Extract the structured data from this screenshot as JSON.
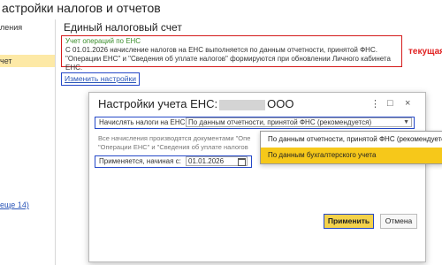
{
  "page_title": "астройки налогов и отчетов",
  "left_panel": {
    "items": [
      "ления",
      "чет"
    ],
    "link": "еще 14)"
  },
  "section_title": "Единый налоговый счет",
  "info_box": {
    "title": "Учет операций по ЕНС",
    "line1": "С 01.01.2026 начисление налогов на ЕНС выполняется по данным отчетности, принятой ФНС.",
    "line2": "\"Операции ЕНС\" и \"Сведения об уплате налогов\" формируются при обновлении Личного кабинета ЕНС."
  },
  "side_note": "текущая",
  "change_link": "Изменить настройки",
  "dialog": {
    "title_prefix": "Настройки учета ЕНС:",
    "title_suffix": "ООО",
    "controls": [
      "⋮",
      "□",
      "×"
    ],
    "accrue_label": "Начислять налоги на ЕНС:",
    "accrue_value": "По данным отчетности, принятой ФНС (рекомендуется)",
    "note_line1": "Все начисления производятся документами \"Опе",
    "note_line2": "\"Операции ЕНС\" и \"Сведения об уплате налогов",
    "date_label": "Применяется, начиная с:",
    "date_value": "01.01.2026",
    "apply_button": "Применить",
    "cancel_button": "Отмена"
  },
  "dropdown_options": [
    "По данным отчетности, принятой ФНС (рекомендуется)",
    "По данным бухгалтерского учета"
  ],
  "colors": {
    "accent_yellow": "#f6c81a",
    "highlight_blue": "#2448c8",
    "alert_red": "#d41a1a",
    "link_blue": "#2b56b8",
    "green_title": "#3b8e2c"
  }
}
